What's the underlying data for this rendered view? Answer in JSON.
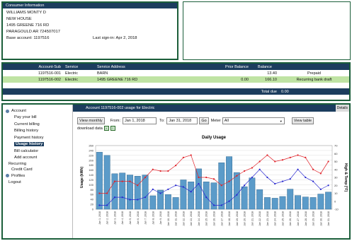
{
  "consumer": {
    "header": "Consumer Information",
    "name": "WILLIAMS MONTY D",
    "line2": "NEW HOUSE",
    "street": "1495 GREENE 716 RD",
    "city": "PARAGOULD AR   724507017",
    "base_account_label": "Base account: 1197516",
    "last_signin": "Last sign-in: Apr 2, 2018"
  },
  "accounts": {
    "headers": [
      "Account-Sub",
      "Service",
      "Service Address",
      "Prior Balance",
      "Balance",
      ""
    ],
    "rows": [
      {
        "account": "1197516-001",
        "service": "Electric",
        "address": "BARN",
        "prior": "",
        "balance": "13.40",
        "note": "Prepaid"
      },
      {
        "account": "1197516-002",
        "service": "Electric",
        "address": "1495 GREENE 716 RD",
        "prior": "0.00",
        "balance": "166.10",
        "note": "Recurring bank draft"
      }
    ],
    "total_label": "Total due",
    "total_value": "0.00"
  },
  "nav": {
    "account_label": "Account",
    "items": [
      "Pay your bill",
      "Current billing",
      "Billing history",
      "Payment history",
      "Usage history",
      "Bill calculator",
      "Add account"
    ],
    "active_item": "Usage history",
    "recurring": "Recurring",
    "credit_card": "Credit Card",
    "profiles_label": "Profiles",
    "logout": "Logout"
  },
  "content": {
    "title": "Account 1197516-002 usage for Electric",
    "details_label": "Details",
    "view_monthly": "View monthly",
    "from_label": "From:",
    "from_value": "Jan 1, 2018",
    "to_label": "To:",
    "to_value": "Jan 31, 2018",
    "go": "Go",
    "meter_label": "Meter",
    "meter_value": "All",
    "view_table": "View table",
    "download_label": "download data"
  },
  "colors": {
    "bar": "#5b9bc9",
    "high_temp": "#e0232a",
    "low_temp": "#2a2ad0",
    "header": "#1c3d5e",
    "frame": "#1b5e3a",
    "selected_row": "#bfe3a3"
  },
  "chart_data": {
    "type": "bar",
    "title": "Daily Usage",
    "ylabel": "Usage (kWh)",
    "y2label": "High & Temp (°F)",
    "ylim": [
      0,
      260
    ],
    "y2lim": [
      -10,
      70
    ],
    "categories": [
      "Jan 1, 2018",
      "Jan 2, 2018",
      "Jan 3, 2018",
      "Jan 4, 2018",
      "Jan 5, 2018",
      "Jan 6, 2018",
      "Jan 7, 2018",
      "Jan 8, 2018",
      "Jan 9, 2018",
      "Jan 10, 2018",
      "Jan 11, 2018",
      "Jan 12, 2018",
      "Jan 13, 2018",
      "Jan 14, 2018",
      "Jan 15, 2018",
      "Jan 16, 2018",
      "Jan 17, 2018",
      "Jan 18, 2018",
      "Jan 19, 2018",
      "Jan 20, 2018",
      "Jan 21, 2018",
      "Jan 22, 2018",
      "Jan 23, 2018",
      "Jan 24, 2018",
      "Jan 25, 2018",
      "Jan 26, 2018",
      "Jan 27, 2018",
      "Jan 28, 2018",
      "Jan 29, 2018",
      "Jan 30, 2018",
      "Jan 31, 2018"
    ],
    "y_ticks": [
      0,
      20,
      40,
      60,
      80,
      100,
      120,
      140,
      160,
      180,
      200,
      220,
      240,
      260
    ],
    "y2_ticks": [
      -10,
      0,
      10,
      20,
      30,
      40,
      50,
      60,
      70
    ],
    "series": [
      {
        "name": "Usage",
        "axis": "left",
        "kind": "bar",
        "values": [
          233,
          220,
          145,
          148,
          140,
          135,
          140,
          55,
          78,
          60,
          48,
          120,
          112,
          165,
          112,
          108,
          190,
          215,
          150,
          92,
          128,
          80,
          48,
          45,
          52,
          82,
          56,
          50,
          48,
          62,
          70
        ]
      },
      {
        "name": "High",
        "axis": "right",
        "kind": "line",
        "values": [
          10,
          10,
          25,
          25,
          25,
          20,
          30,
          40,
          38,
          38,
          45,
          55,
          58,
          30,
          30,
          28,
          20,
          25,
          32,
          38,
          42,
          50,
          58,
          50,
          52,
          55,
          58,
          55,
          40,
          35,
          50
        ]
      },
      {
        "name": "Low",
        "axis": "right",
        "kind": "line",
        "values": [
          -5,
          -5,
          5,
          5,
          2,
          2,
          5,
          15,
          10,
          15,
          20,
          18,
          12,
          22,
          5,
          -5,
          -5,
          0,
          8,
          20,
          30,
          40,
          30,
          22,
          25,
          28,
          40,
          30,
          25,
          15,
          20
        ]
      }
    ]
  }
}
